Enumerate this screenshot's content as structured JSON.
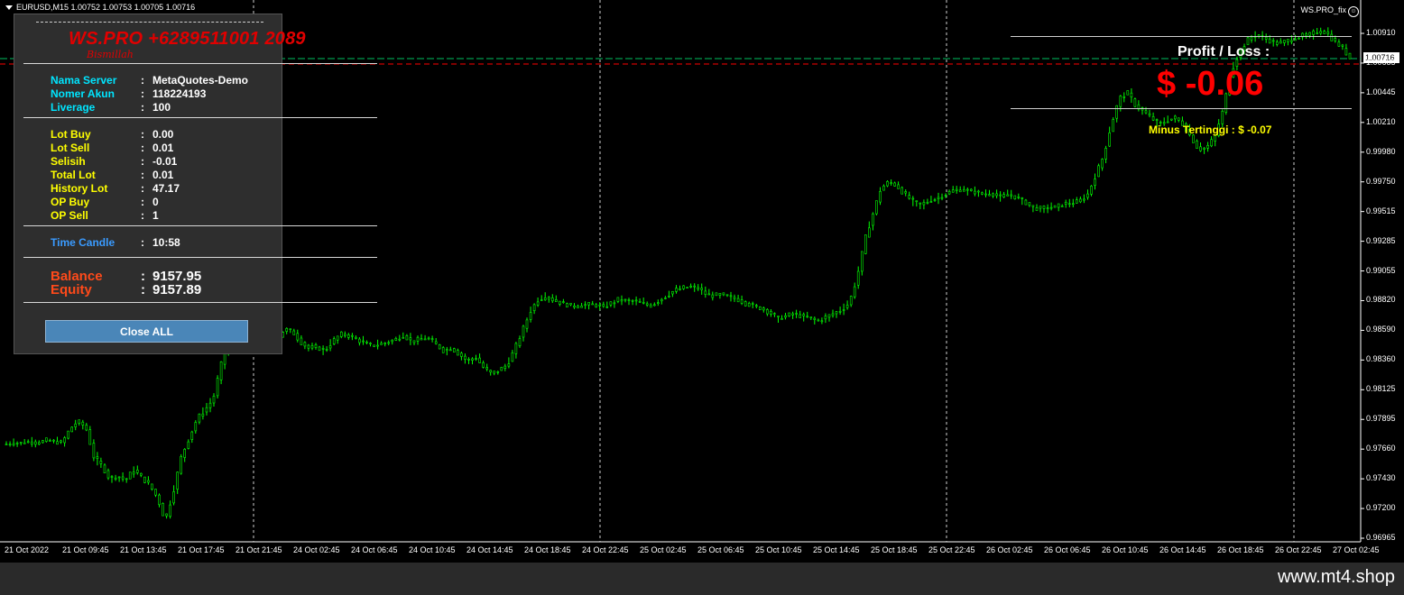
{
  "chart": {
    "symbol_line": "EURUSD,M15  1.00752 1.00753 1.00705 1.00716",
    "ea_name": "WS.PRO_fix",
    "current_price_tag": "1.00716",
    "y_axis_labels": [
      "1.00910",
      "1.00685",
      "1.00445",
      "1.00210",
      "0.99980",
      "0.99750",
      "0.99515",
      "0.99285",
      "0.99055",
      "0.98820",
      "0.98590",
      "0.98360",
      "0.98125",
      "0.97895",
      "0.97660",
      "0.97430",
      "0.97200",
      "0.96965"
    ],
    "x_axis_labels": [
      "21 Oct 2022",
      "21 Oct 09:45",
      "21 Oct 13:45",
      "21 Oct 17:45",
      "21 Oct 21:45",
      "24 Oct 02:45",
      "24 Oct 06:45",
      "24 Oct 10:45",
      "24 Oct 14:45",
      "24 Oct 18:45",
      "24 Oct 22:45",
      "25 Oct 02:45",
      "25 Oct 06:45",
      "25 Oct 10:45",
      "25 Oct 14:45",
      "25 Oct 18:45",
      "25 Oct 22:45",
      "26 Oct 02:45",
      "26 Oct 06:45",
      "26 Oct 10:45",
      "26 Oct 14:45",
      "26 Oct 18:45",
      "26 Oct 22:45",
      "27 Oct 02:45"
    ],
    "candle_color": "#00ff00",
    "background_color": "#000000"
  },
  "chart_data": {
    "type": "line",
    "series": [
      {
        "values": [
          0.977,
          0.9771,
          0.9771,
          0.9772,
          0.9771,
          0.9773,
          0.9772,
          0.9771,
          0.9782,
          0.9788,
          0.9783,
          0.976,
          0.9753,
          0.9743,
          0.9745,
          0.9742,
          0.975,
          0.9744,
          0.9738,
          0.9728,
          0.971,
          0.9733,
          0.976,
          0.9775,
          0.979,
          0.9797,
          0.9805,
          0.9832,
          0.985,
          0.9858,
          0.9862,
          0.9856,
          0.9852,
          0.9855,
          0.985,
          0.986,
          0.9858,
          0.985,
          0.9845,
          0.9846,
          0.9843,
          0.985,
          0.9856,
          0.9855,
          0.9852,
          0.9849,
          0.9847,
          0.9848,
          0.985,
          0.9852,
          0.9855,
          0.985,
          0.9852,
          0.9853,
          0.9848,
          0.9843,
          0.9845,
          0.984,
          0.9835,
          0.9838,
          0.983,
          0.9825,
          0.9828,
          0.9832,
          0.9845,
          0.986,
          0.9875,
          0.9884,
          0.9885,
          0.9882,
          0.988,
          0.9878,
          0.9878,
          0.9879,
          0.9879,
          0.9877,
          0.988,
          0.9883,
          0.9882,
          0.9882,
          0.988,
          0.9878,
          0.9882,
          0.9886,
          0.989,
          0.9892,
          0.9893,
          0.9892,
          0.9887,
          0.9886,
          0.9887,
          0.9885,
          0.9883,
          0.988,
          0.9878,
          0.9876,
          0.9873,
          0.9868,
          0.987,
          0.9872,
          0.987,
          0.9869,
          0.9866,
          0.9869,
          0.9872,
          0.9875,
          0.988,
          0.99,
          0.993,
          0.995,
          0.997,
          0.9975,
          0.9972,
          0.9965,
          0.996,
          0.9957,
          0.996,
          0.9962,
          0.9965,
          0.9968,
          0.9969,
          0.9968,
          0.9967,
          0.9965,
          0.9966,
          0.9963,
          0.9965,
          0.9963,
          0.996,
          0.9955,
          0.9954,
          0.9955,
          0.9955,
          0.9958,
          0.9958,
          0.996,
          0.9965,
          0.998,
          0.9995,
          1.002,
          1.004,
          1.0045,
          1.0035,
          1.003,
          1.0025,
          1.002,
          1.0023,
          1.0025,
          1.002,
          1.001,
          1.0,
          1.0002,
          1.001,
          1.003,
          1.006,
          1.0075,
          1.0085,
          1.009,
          1.0088,
          1.0085,
          1.0083,
          1.0085,
          1.0087,
          1.0089,
          1.009,
          1.0093,
          1.0092,
          1.0085,
          1.008,
          1.00716
        ]
      }
    ],
    "ylim": [
      0.96965,
      1.0091
    ]
  },
  "panel": {
    "brand": "WS.PRO +6289511001 2089",
    "subtitle": "Bismillah",
    "info": [
      {
        "label": "Nama Server",
        "value": "MetaQuotes-Demo"
      },
      {
        "label": "Nomer Akun",
        "value": "118224193"
      },
      {
        "label": "Liverage",
        "value": "100"
      }
    ],
    "lots": [
      {
        "label": "Lot Buy",
        "value": "0.00"
      },
      {
        "label": "Lot Sell",
        "value": "0.01"
      },
      {
        "label": "Selisih",
        "value": "-0.01"
      },
      {
        "label": "Total Lot",
        "value": "0.01"
      },
      {
        "label": "History Lot",
        "value": "47.17"
      },
      {
        "label": "OP Buy",
        "value": "0"
      },
      {
        "label": "OP Sell",
        "value": "1"
      }
    ],
    "time_candle": {
      "label": "Time Candle",
      "value": "10:58"
    },
    "balance": {
      "label": "Balance",
      "value": "9157.95"
    },
    "equity": {
      "label": "Equity",
      "value": "9157.89"
    },
    "separator": ":",
    "close_all_label": "Close ALL"
  },
  "profit": {
    "label": "Profit / Loss :",
    "value": "$ -0.06",
    "minus_high": "Minus Tertinggi  : $ -0.07"
  },
  "footer": {
    "text": "www.mt4.shop"
  }
}
